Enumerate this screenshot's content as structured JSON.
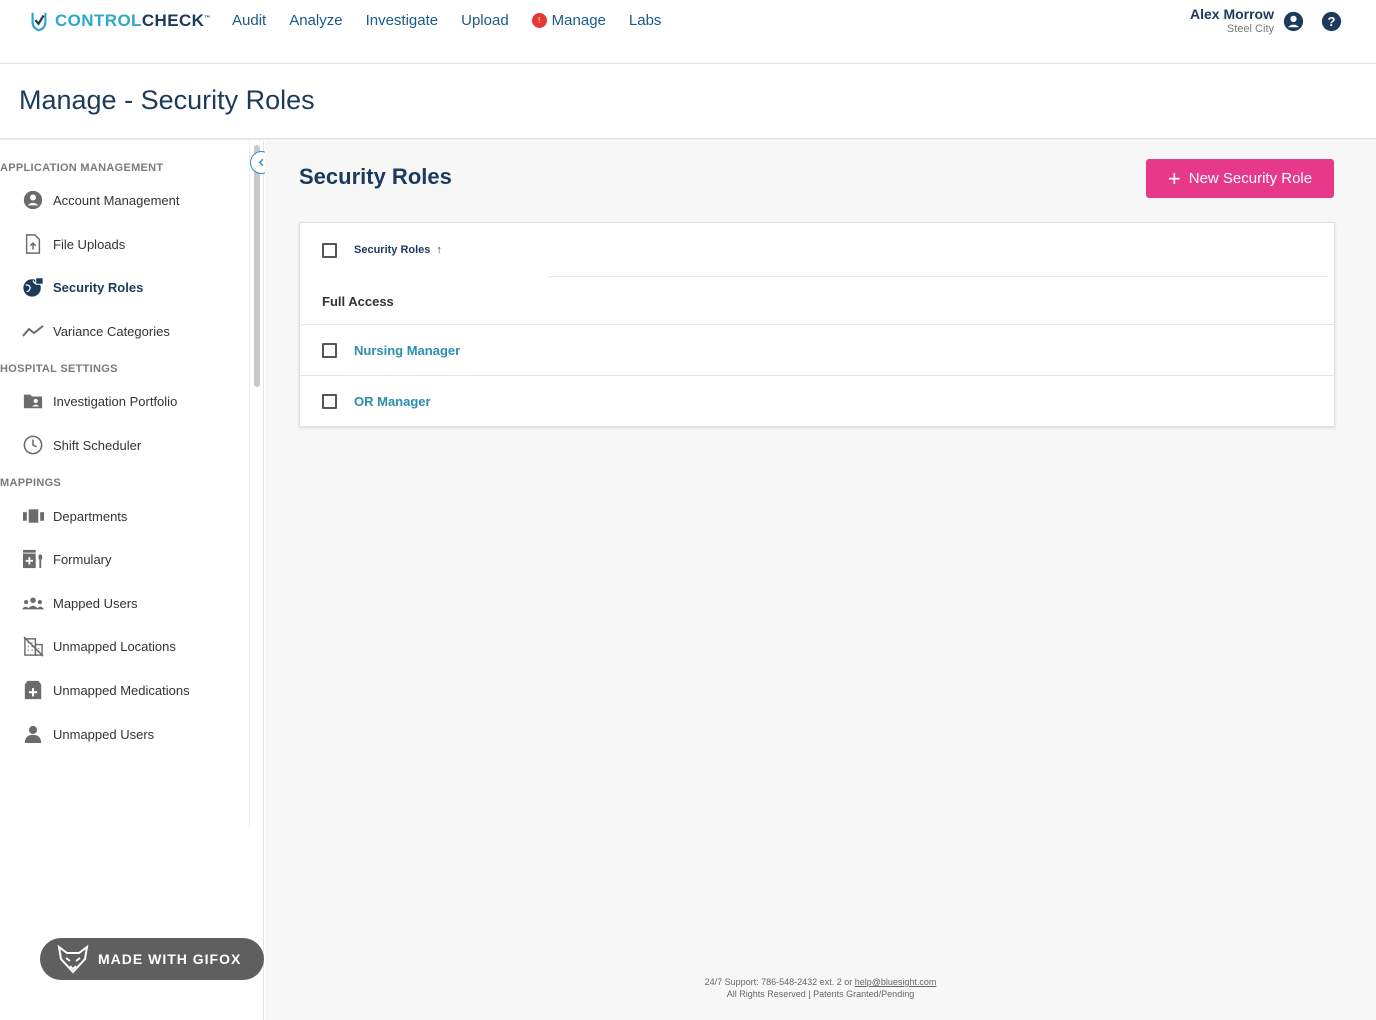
{
  "brand": {
    "part1": "CONTROL",
    "part2": "CHECK",
    "tm": "™"
  },
  "nav": {
    "audit": "Audit",
    "analyze": "Analyze",
    "investigate": "Investigate",
    "upload": "Upload",
    "manage": "Manage",
    "manage_badge": "!",
    "labs": "Labs"
  },
  "user": {
    "name": "Alex Morrow",
    "site": "Steel City"
  },
  "page": {
    "title": "Manage - Security Roles"
  },
  "sidebar": {
    "sections": {
      "app": "APPLICATION MANAGEMENT",
      "hospital": "HOSPITAL SETTINGS",
      "mappings": "MAPPINGS"
    },
    "items": {
      "account": "Account Management",
      "file_uploads": "File Uploads",
      "security_roles": "Security Roles",
      "variance": "Variance Categories",
      "investigation": "Investigation Portfolio",
      "shift": "Shift Scheduler",
      "departments": "Departments",
      "formulary": "Formulary",
      "mapped_users": "Mapped Users",
      "unmapped_locations": "Unmapped Locations",
      "unmapped_medications": "Unmapped Medications",
      "unmapped_users": "Unmapped Users"
    }
  },
  "main": {
    "title": "Security Roles",
    "new_button": "New Security Role",
    "table": {
      "header": "Security Roles",
      "sort_indicator": "↑",
      "group": "Full Access",
      "rows": [
        "Nursing Manager",
        "OR Manager"
      ]
    }
  },
  "footer": {
    "support": "24/7 Support: 786-548-2432 ext. 2 or ",
    "email": "help@bluesight.com",
    "rights": "All Rights Reserved | Patents Granted/Pending"
  },
  "watermark": "MADE WITH GIFOX",
  "colors": {
    "accent": "#e6398c",
    "brand_navy": "#1b3a5c",
    "brand_teal": "#31a7c9",
    "link": "#2a8fb0",
    "badge": "#e53935"
  }
}
